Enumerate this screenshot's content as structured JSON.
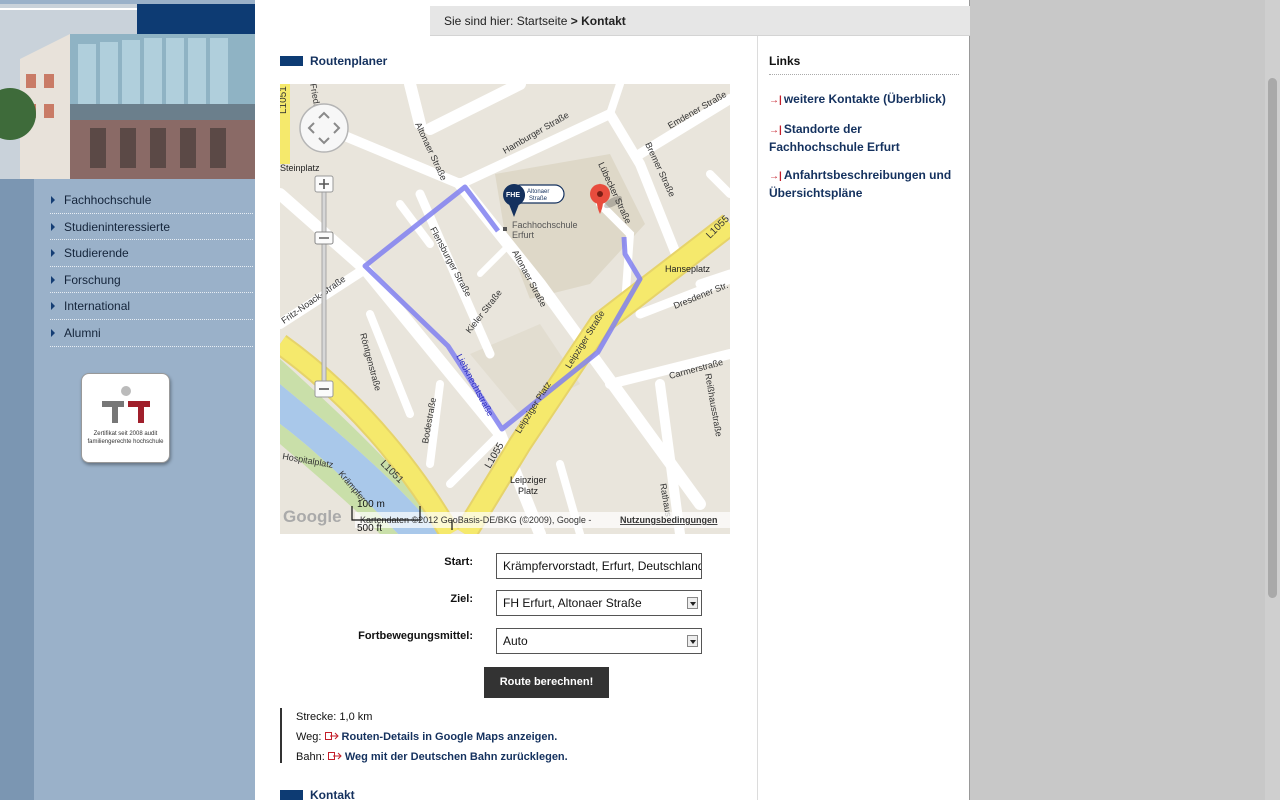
{
  "breadcrumb": {
    "prefix": "Sie sind hier:",
    "home": "Startseite",
    "separator": ">",
    "current": "Kontakt"
  },
  "nav": {
    "items": [
      {
        "label": "Fachhochschule"
      },
      {
        "label": "Studieninteressierte"
      },
      {
        "label": "Studierende"
      },
      {
        "label": "Forschung"
      },
      {
        "label": "International"
      },
      {
        "label": "Alumni"
      }
    ]
  },
  "certificate": {
    "text": "Zertifikat seit 2008 audit familiengerechte hochschule"
  },
  "routenplaner": {
    "title": "Routenplaner"
  },
  "map": {
    "streets": {
      "hamburger": "Hamburger Straße",
      "altonaer1": "Altonaer Straße",
      "altonaer2": "Altonaer Straße",
      "flensburger": "Flensburger Straße",
      "kieler": "Kieler Straße",
      "bremer": "Bremer Straße",
      "luebecker": "Lübecker Straße",
      "emdener": "Emdener Straße",
      "dresdener": "Dresdener Str.",
      "carmerstr": "Carmerstraße",
      "reisshaus": "Reißhausstraße",
      "roentgen": "Röntgenstraße",
      "bode": "Bodestraße",
      "liebknecht": "Liebknechtstraße",
      "leipziger_platz": "Leipziger Platz",
      "leipziger_str": "Leipziger Straße",
      "noack": "Fritz-Noack-Straße",
      "kraempfer": "Krämpfer",
      "rathaus": "Rathaus",
      "hospital": "Hospitalplatz",
      "friedrich": "Friedrich-E"
    },
    "places": {
      "steinplatz": "Steinplatz",
      "hanseplatz": "Hanseplatz",
      "leipziger_platz_l1": "Leipziger",
      "leipziger_platz_l2": "Platz",
      "fh_l1": "Fachhochschule",
      "fh_l2": "Erfurt"
    },
    "roads": {
      "l1055a": "L1055",
      "l1055b": "L1055",
      "l1051a": "L1051",
      "l1051b": "L1051"
    },
    "stop_badge": {
      "line1": "Altonaer",
      "line2": "Straße",
      "logo": "FHE"
    },
    "scale": {
      "metric": "100 m",
      "imperial": "500 ft"
    },
    "attribution": "Kartendaten ©2012 GeoBasis-DE/BKG (©2009), Google -",
    "terms": "Nutzungsbedingungen",
    "google": "Google",
    "zoom_fraction": 0.72
  },
  "form": {
    "start_label": "Start:",
    "start_value": "Krämpfervorstadt, Erfurt, Deutschland",
    "ziel_label": "Ziel:",
    "ziel_value": "FH Erfurt, Altonaer Straße",
    "mode_label": "Fortbewegungsmittel:",
    "mode_value": "Auto",
    "submit": "Route berechnen!"
  },
  "result": {
    "distance_label": "Strecke:",
    "distance_value": "1,0 km",
    "weg_label": "Weg:",
    "weg_link": "Routen-Details in Google Maps anzeigen.",
    "bahn_label": "Bahn:",
    "bahn_link": "Weg mit der Deutschen Bahn zurücklegen."
  },
  "kontakt": {
    "title": "Kontakt"
  },
  "links": {
    "title": "Links",
    "items": [
      {
        "label": "weitere Kontakte (Überblick)"
      },
      {
        "label": "Standorte der Fachhochschule Erfurt"
      },
      {
        "label": "Anfahrtsbeschreibungen und Übersichtspläne"
      }
    ]
  },
  "colors": {
    "accent": "#0d3b73",
    "link": "#14315e",
    "route": "#8080f0",
    "highway": "#f5e96c"
  }
}
